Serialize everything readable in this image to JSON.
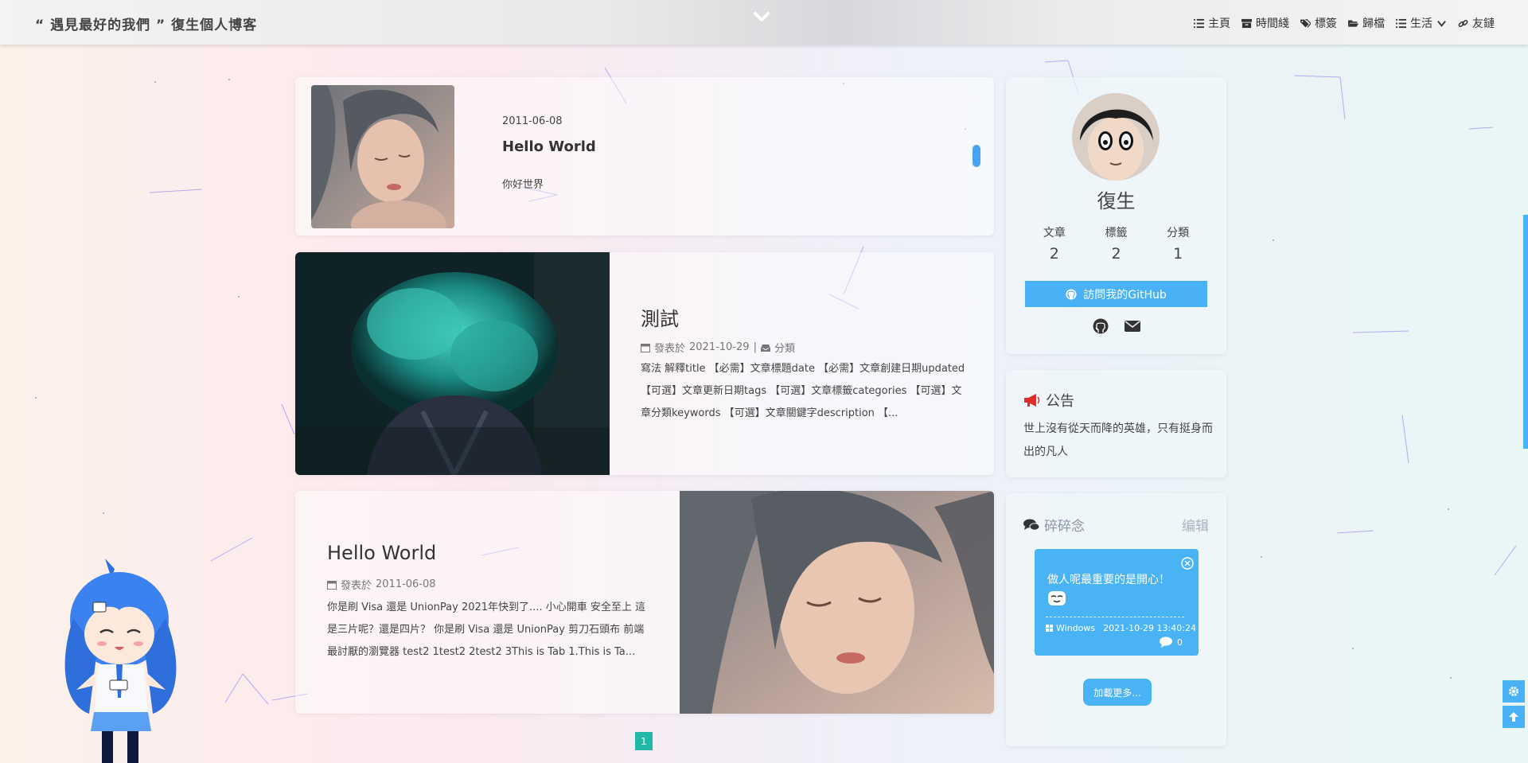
{
  "header": {
    "site_title": "“ 遇見最好的我們 ” 復生個人博客",
    "nav": [
      {
        "label": "主頁",
        "icon": "list-icon"
      },
      {
        "label": "時間綫",
        "icon": "archive-icon"
      },
      {
        "label": "標簽",
        "icon": "tags-icon"
      },
      {
        "label": "歸檔",
        "icon": "folder-icon"
      },
      {
        "label": "生活",
        "icon": "list-icon"
      },
      {
        "label": "友鏈",
        "icon": "link-icon"
      }
    ]
  },
  "posts": [
    {
      "date": "2011-06-08",
      "title": "Hello World",
      "excerpt": "你好世界"
    },
    {
      "title": "測試",
      "meta_prefix": "發表於",
      "date": "2021-10-29",
      "separator": "|",
      "category": "分類",
      "body": "寫法 解釋title 【必需】文章標題date 【必需】文章創建日期updated 【可選】文章更新日期tags 【可選】文章標籤categories 【可選】文章分類keywords 【可選】文章關鍵字description 【..."
    },
    {
      "title": "Hello World",
      "meta_prefix": "發表於",
      "date": "2011-06-08",
      "body": "你是刷 Visa 還是 UnionPay 2021年快到了.... 小心開車 安全至上 這是三片呢？還是四片？ 你是刷 Visa 還是 UnionPay 剪刀石頭布 前端最討厭的瀏覽器 test2 1test2 2test2 3This is Tab 1.This is Ta..."
    }
  ],
  "profile": {
    "name": "復生",
    "stats": [
      {
        "label": "文章",
        "value": "2"
      },
      {
        "label": "標籤",
        "value": "2"
      },
      {
        "label": "分類",
        "value": "1"
      }
    ],
    "github_button": "訪問我的GitHub"
  },
  "announcement": {
    "title": "公告",
    "body": "世上沒有從天而降的英雄，只有挺身而出的凡人"
  },
  "talk": {
    "title": "碎碎念",
    "edit": "编辑",
    "text": "做人呢最重要的是開心！",
    "os": "Windows",
    "time": "2021-10-29 13:40:24",
    "comments": "0",
    "load_more": "加載更多..."
  },
  "pagination": {
    "current": "1"
  },
  "colors": {
    "accent": "#49b1f5",
    "pager": "#21b8a8"
  }
}
